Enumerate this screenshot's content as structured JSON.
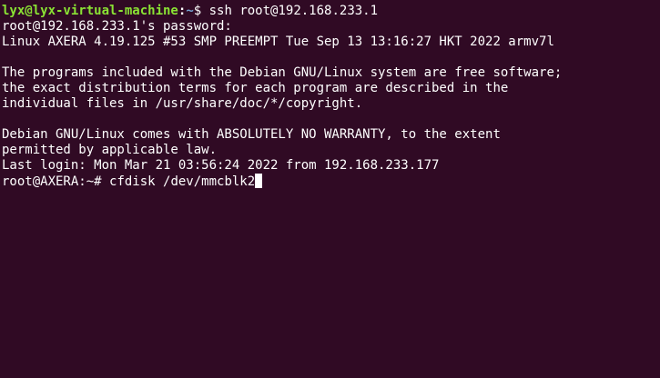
{
  "terminal": {
    "local_prompt": {
      "user_host": "lyx@lyx-virtual-machine",
      "separator": ":",
      "path": "~",
      "symbol": "$ ",
      "command": "ssh root@192.168.233.1"
    },
    "lines": [
      "root@192.168.233.1's password:",
      "Linux AXERA 4.19.125 #53 SMP PREEMPT Tue Sep 13 13:16:27 HKT 2022 armv7l",
      "",
      "The programs included with the Debian GNU/Linux system are free software;",
      "the exact distribution terms for each program are described in the",
      "individual files in /usr/share/doc/*/copyright.",
      "",
      "Debian GNU/Linux comes with ABSOLUTELY NO WARRANTY, to the extent",
      "permitted by applicable law.",
      "Last login: Mon Mar 21 03:56:24 2022 from 192.168.233.177"
    ],
    "remote_prompt": {
      "prompt": "root@AXERA:~# ",
      "command": "cfdisk /dev/mmcblk2"
    },
    "colors": {
      "background": "#300a24",
      "foreground": "#ffffff",
      "user_host": "#8ae234",
      "path": "#729fcf"
    }
  }
}
